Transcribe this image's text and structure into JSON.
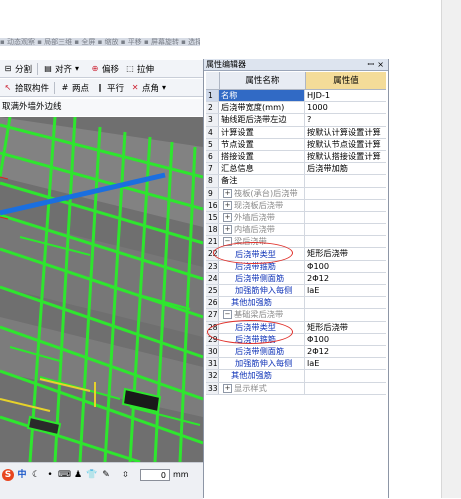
{
  "top_strip": {
    "text": "▪ 动态观察 ▪ 局部三维 ▪ 全屏 ▪ 缩放 ▪ 平移 ▪ 屏幕旋转 ▪ 选择楼层"
  },
  "toolbar1": {
    "split": "分割",
    "align": "对齐",
    "offset": "偏移",
    "stretch": "拉伸"
  },
  "toolbar2": {
    "pick": "拾取构件",
    "two_points": "两点",
    "parallel": "平行",
    "point_angle": "点角"
  },
  "edge_label": "取满外墙外边线",
  "status": {
    "zhong": "中",
    "spin_label": "⇳",
    "spin_value": "0",
    "unit": "mm"
  },
  "panel": {
    "title": "属性编辑器",
    "pin": "ꟷ",
    "close": "×",
    "col_name": "属性名称",
    "col_value": "属性值"
  },
  "rows": [
    {
      "num": "1",
      "name": "名称",
      "value": "HJD-1",
      "style": "selected",
      "indent": 1,
      "pm": ""
    },
    {
      "num": "2",
      "name": "后浇带宽度(mm)",
      "value": "1000",
      "style": "",
      "indent": 1,
      "pm": ""
    },
    {
      "num": "3",
      "name": "轴线距后浇带左边",
      "value": "?",
      "style": "",
      "indent": 1,
      "pm": ""
    },
    {
      "num": "4",
      "name": "计算设置",
      "value": "按默认计算设置计算",
      "style": "",
      "indent": 1,
      "pm": ""
    },
    {
      "num": "5",
      "name": "节点设置",
      "value": "按默认节点设置计算",
      "style": "",
      "indent": 1,
      "pm": ""
    },
    {
      "num": "6",
      "name": "搭接设置",
      "value": "按默认搭接设置计算",
      "style": "",
      "indent": 1,
      "pm": ""
    },
    {
      "num": "7",
      "name": "汇总信息",
      "value": "后浇带加筋",
      "style": "",
      "indent": 1,
      "pm": ""
    },
    {
      "num": "8",
      "name": "备注",
      "value": "",
      "style": "",
      "indent": 1,
      "pm": ""
    },
    {
      "num": "9",
      "name": "筏板(承台)后浇带",
      "value": "",
      "style": "gray",
      "indent": 2,
      "pm": "+"
    },
    {
      "num": "16",
      "name": "现浇板后浇带",
      "value": "",
      "style": "gray",
      "indent": 2,
      "pm": "+"
    },
    {
      "num": "15",
      "name": "外墙后浇带",
      "value": "",
      "style": "gray",
      "indent": 2,
      "pm": "+"
    },
    {
      "num": "18",
      "name": "内墙后浇带",
      "value": "",
      "style": "gray",
      "indent": 2,
      "pm": "+"
    },
    {
      "num": "21",
      "name": "梁后浇带",
      "value": "",
      "style": "gray",
      "indent": 2,
      "pm": "−"
    },
    {
      "num": "22",
      "name": "后浇带类型",
      "value": "矩形后浇带",
      "style": "blue",
      "indent": 4,
      "pm": ""
    },
    {
      "num": "23",
      "name": "后浇带箍筋",
      "value": "Φ100",
      "style": "blue",
      "indent": 4,
      "pm": ""
    },
    {
      "num": "24",
      "name": "后浇带侧面筋",
      "value": "2Φ12",
      "style": "blue",
      "indent": 4,
      "pm": ""
    },
    {
      "num": "25",
      "name": "加强筋伸入每侧",
      "value": "laE",
      "style": "blue",
      "indent": 4,
      "pm": ""
    },
    {
      "num": "26",
      "name": "其他加强筋",
      "value": "",
      "style": "blue",
      "indent": 3,
      "pm": ""
    },
    {
      "num": "27",
      "name": "基础梁后浇带",
      "value": "",
      "style": "gray",
      "indent": 2,
      "pm": "−"
    },
    {
      "num": "28",
      "name": "后浇带类型",
      "value": "矩形后浇带",
      "style": "blue",
      "indent": 4,
      "pm": ""
    },
    {
      "num": "29",
      "name": "后浇带箍筋",
      "value": "Φ100",
      "style": "blue",
      "indent": 4,
      "pm": ""
    },
    {
      "num": "30",
      "name": "后浇带侧面筋",
      "value": "2Φ12",
      "style": "blue",
      "indent": 4,
      "pm": ""
    },
    {
      "num": "31",
      "name": "加强筋伸入每侧",
      "value": "laE",
      "style": "blue",
      "indent": 4,
      "pm": ""
    },
    {
      "num": "32",
      "name": "其他加强筋",
      "value": "",
      "style": "blue",
      "indent": 3,
      "pm": ""
    },
    {
      "num": "33",
      "name": "显示样式",
      "value": "",
      "style": "gray",
      "indent": 2,
      "pm": "+"
    }
  ],
  "colors": {
    "selected": "#316ac5",
    "header_value": "#f4dc99",
    "beam_green": "#2ee62e",
    "slab_gray": "#7d7d7d",
    "blue_beam": "#1a6fe0",
    "annotation_red": "#e0302a"
  }
}
